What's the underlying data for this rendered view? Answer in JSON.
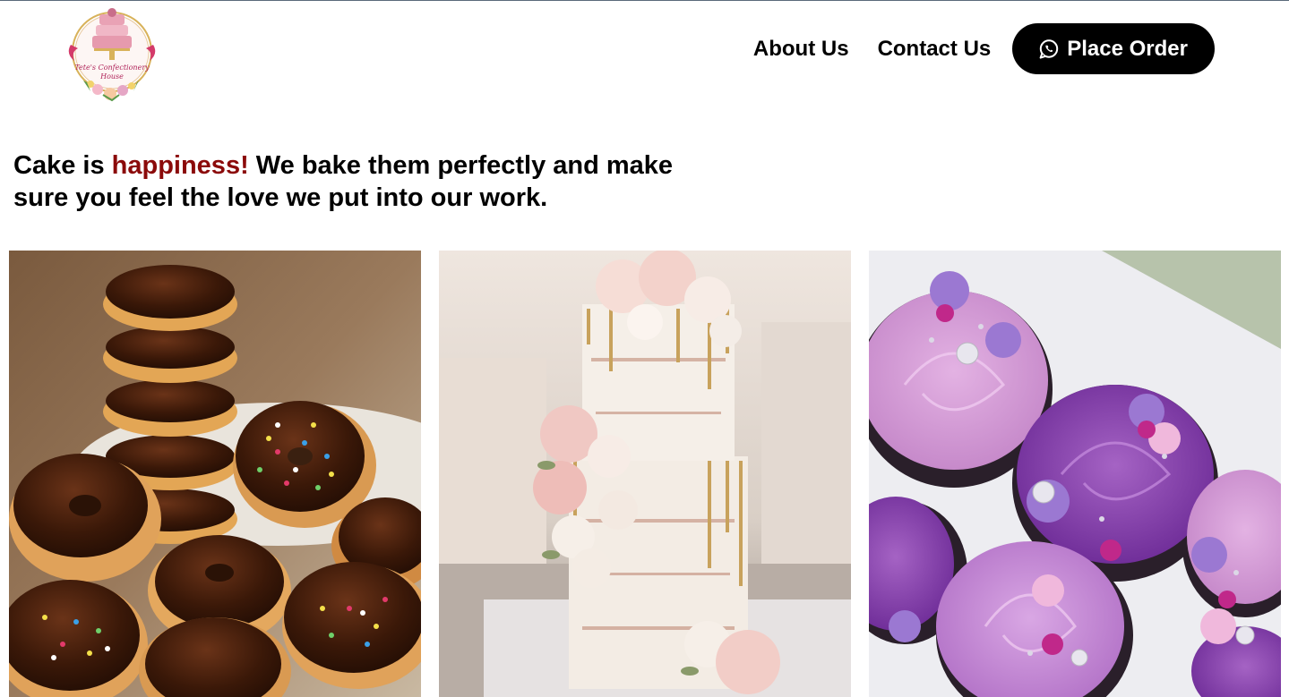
{
  "brand": {
    "logo_text": "Tete's Confectionery House",
    "logo_icon": "cake-wreath-logo"
  },
  "nav": {
    "about_label": "About Us",
    "contact_label": "Contact Us",
    "order_label": "Place Order",
    "order_icon": "whatsapp-icon"
  },
  "hero": {
    "tagline_before": "Cake is ",
    "tagline_accent": "happiness!",
    "tagline_after": " We bake them perfectly and make sure you feel the love we put into our work."
  },
  "gallery": [
    {
      "alt": "Stack of chocolate glazed donuts with sprinkles"
    },
    {
      "alt": "Two-tier naked cake with gold drip and pink roses"
    },
    {
      "alt": "Purple and pink rose-piped cupcakes in a box"
    }
  ],
  "colors": {
    "accent": "#8b0a0a",
    "button_bg": "#000000",
    "button_text": "#ffffff"
  }
}
